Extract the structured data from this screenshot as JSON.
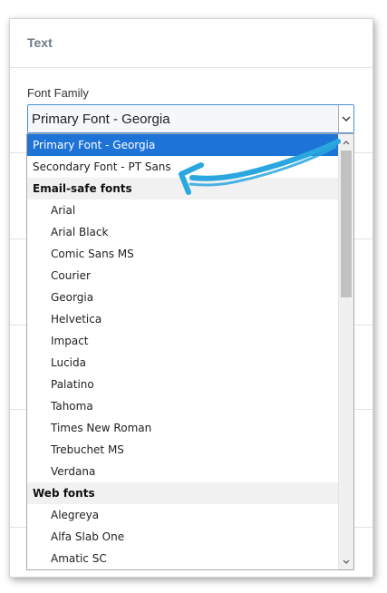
{
  "panel": {
    "title": "Text"
  },
  "field": {
    "label": "Font Family",
    "selected_value": "Primary Font - Georgia"
  },
  "dropdown": {
    "options": [
      {
        "label": "Primary Font - Georgia",
        "kind": "top",
        "selected": true
      },
      {
        "label": "Secondary Font - PT Sans",
        "kind": "top",
        "selected": false
      },
      {
        "label": "Email-safe fonts",
        "kind": "group"
      },
      {
        "label": "Arial",
        "kind": "child"
      },
      {
        "label": "Arial Black",
        "kind": "child"
      },
      {
        "label": "Comic Sans MS",
        "kind": "child"
      },
      {
        "label": "Courier",
        "kind": "child"
      },
      {
        "label": "Georgia",
        "kind": "child"
      },
      {
        "label": "Helvetica",
        "kind": "child"
      },
      {
        "label": "Impact",
        "kind": "child"
      },
      {
        "label": "Lucida",
        "kind": "child"
      },
      {
        "label": "Palatino",
        "kind": "child"
      },
      {
        "label": "Tahoma",
        "kind": "child"
      },
      {
        "label": "Times New Roman",
        "kind": "child"
      },
      {
        "label": "Trebuchet MS",
        "kind": "child"
      },
      {
        "label": "Verdana",
        "kind": "child"
      },
      {
        "label": "Web fonts",
        "kind": "group"
      },
      {
        "label": "Alegreya",
        "kind": "child"
      },
      {
        "label": "Alfa Slab One",
        "kind": "child"
      },
      {
        "label": "Amatic SC",
        "kind": "child"
      }
    ]
  },
  "colors": {
    "selection": "#1e73d6",
    "focus_border": "#4a90d9",
    "annotation": "#2aa7e0",
    "title_text": "#6c7a89"
  },
  "icons": {
    "select_arrow": "chevron-down-icon",
    "scroll_up": "scroll-up-icon",
    "scroll_down": "scroll-down-icon",
    "annotation": "arrow-annotation-icon"
  }
}
